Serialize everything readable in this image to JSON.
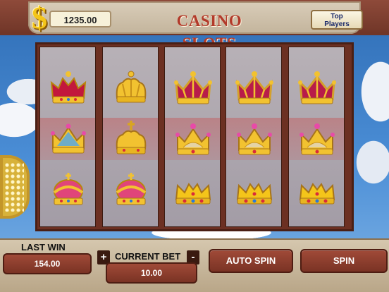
{
  "header": {
    "currency_symbol": "$",
    "balance": "1235.00",
    "title": "CASINO SLOTS",
    "top_players_line1": "Top",
    "top_players_line2": "Players"
  },
  "reels": [
    [
      "crown-red",
      "crown-blue-pink",
      "crown-pink-round"
    ],
    [
      "crown-gold-plain",
      "crown-gold-cross",
      "crown-pink-round"
    ],
    [
      "crown-red-gold",
      "crown-gold-jewel",
      "crown-gold-open"
    ],
    [
      "crown-red-gold",
      "crown-gold-jewel",
      "crown-gold-open"
    ],
    [
      "crown-red-gold",
      "crown-gold-jewel",
      "crown-gold-open"
    ]
  ],
  "footer": {
    "last_win_label": "LAST WIN",
    "last_win_value": "154.00",
    "plus": "+",
    "minus": "-",
    "current_bet_label": "CURRENT BET",
    "current_bet_value": "10.00",
    "auto_spin_label": "AUTO SPIN",
    "spin_label": "SPIN"
  },
  "colors": {
    "brown": "#7a3324",
    "gold": "#f4c51a",
    "title_red": "#b23a2a"
  }
}
